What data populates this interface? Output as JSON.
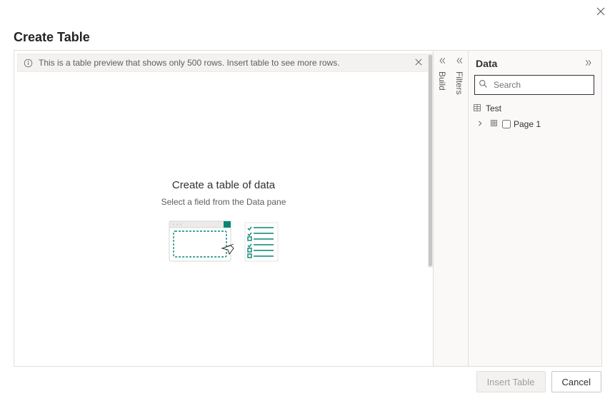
{
  "dialog": {
    "title": "Create Table",
    "close_icon": "close"
  },
  "info_bar": {
    "message": "This is a table preview that shows only 500 rows. Insert table to see more rows.",
    "close_icon": "close"
  },
  "empty_state": {
    "title": "Create a table of data",
    "subtitle": "Select a field from the Data pane"
  },
  "panel_tabs": {
    "build": "Build",
    "filters": "Filters"
  },
  "data_pane": {
    "title": "Data",
    "search_placeholder": "Search",
    "tree": {
      "table_name": "Test",
      "children": [
        {
          "label": "Page 1",
          "checked": false
        }
      ]
    }
  },
  "footer": {
    "insert_label": "Insert Table",
    "insert_enabled": false,
    "cancel_label": "Cancel"
  }
}
